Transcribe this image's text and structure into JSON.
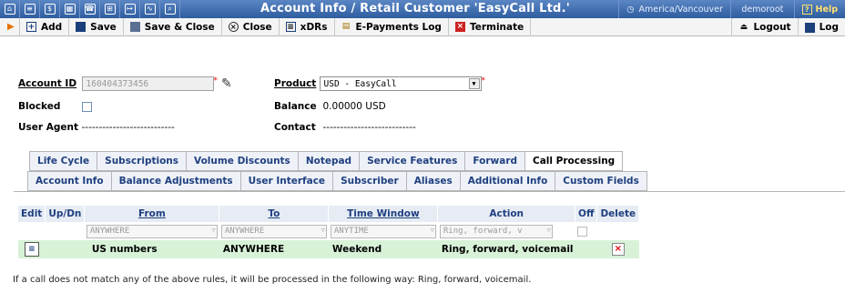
{
  "window": {
    "title": "Account Info / Retail Customer 'EasyCall Ltd.'",
    "timezone": "America/Vancouver",
    "user": "demoroot",
    "help_label": "Help"
  },
  "toolbar": {
    "add": "Add",
    "save": "Save",
    "save_close": "Save & Close",
    "close": "Close",
    "xdrs": "xDRs",
    "epayments": "E-Payments Log",
    "terminate": "Terminate",
    "logout": "Logout",
    "log": "Log"
  },
  "form": {
    "account_id_label": "Account ID",
    "account_id_value": "160404373456",
    "product_label": "Product",
    "product_value": "USD - EasyCall",
    "blocked_label": "Blocked",
    "balance_label": "Balance",
    "balance_value": "0.00000 USD",
    "user_agent_label": "User Agent",
    "user_agent_value": "---------------------------",
    "contact_label": "Contact",
    "contact_value": "---------------------------"
  },
  "tabs": {
    "row1": [
      "Life Cycle",
      "Subscriptions",
      "Volume Discounts",
      "Notepad",
      "Service Features",
      "Forward",
      "Call Processing"
    ],
    "row2": [
      "Account Info",
      "Balance Adjustments",
      "User Interface",
      "Subscriber",
      "Aliases",
      "Additional Info",
      "Custom Fields"
    ],
    "active": "Call Processing"
  },
  "table": {
    "headers": {
      "edit": "Edit",
      "updn": "Up/Dn",
      "from": "From",
      "to": "To",
      "time_window": "Time Window",
      "action": "Action",
      "off": "Off",
      "delete": "Delete"
    },
    "filter": {
      "from": "ANYWHERE",
      "to": "ANYWHERE",
      "time_window": "ANYTIME",
      "action": "Ring, forward, v"
    },
    "rows": [
      {
        "from": "US numbers",
        "to": "ANYWHERE",
        "time_window": "Weekend",
        "action": "Ring, forward, voicemail"
      }
    ]
  },
  "footnote": "If a call does not match any of the above rules, it will be processed in the following way: Ring, forward, voicemail."
}
